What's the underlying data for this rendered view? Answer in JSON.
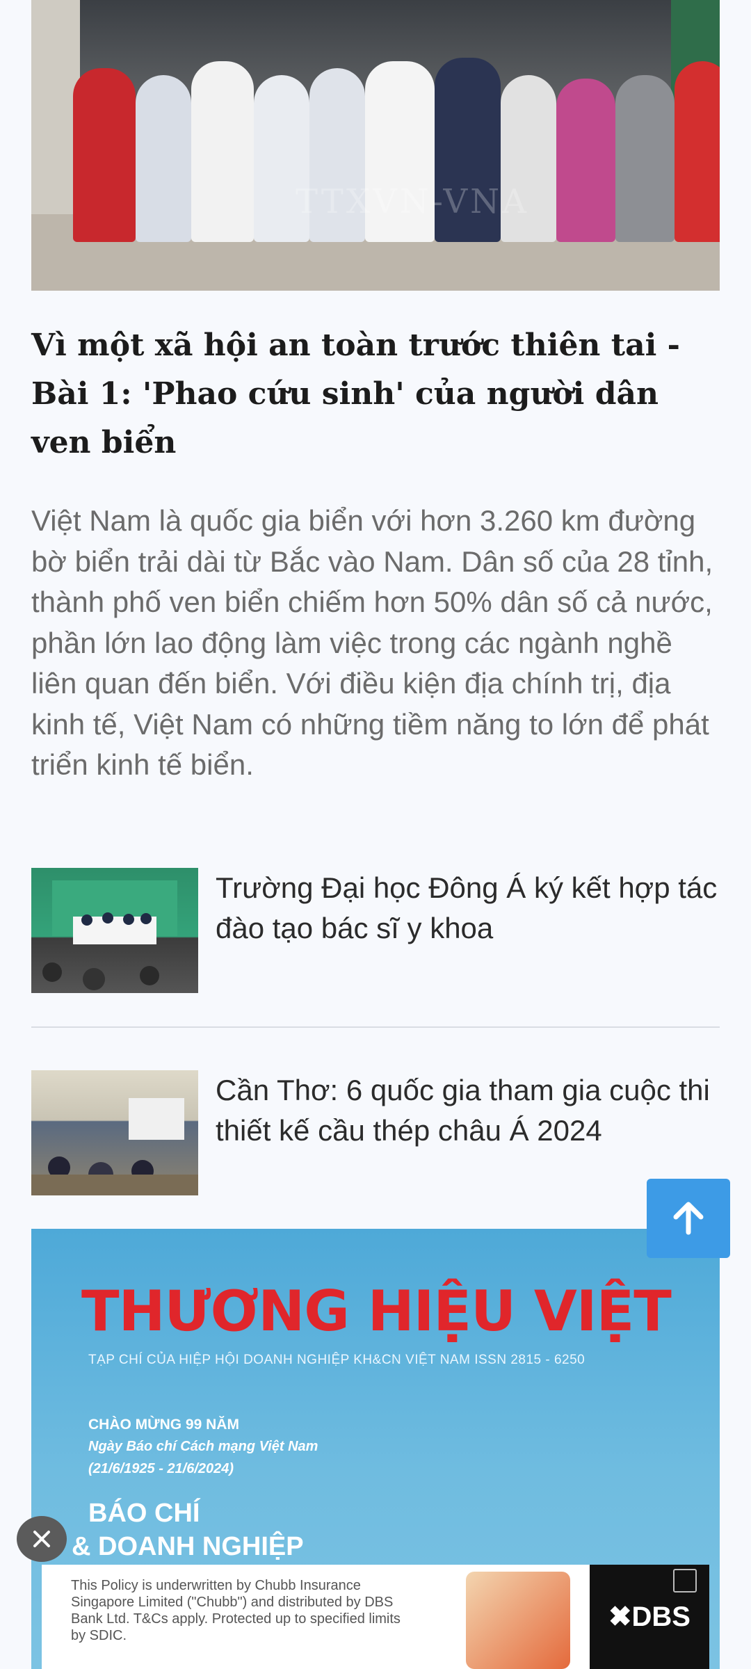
{
  "hero": {
    "watermark": "TTXVN-VNA"
  },
  "article": {
    "title": "Vì một xã hội an toàn trước thiên tai - Bài 1: 'Phao cứu sinh' của người dân ven biển",
    "summary": "Việt Nam là quốc gia biển với hơn 3.260 km đường bờ biển trải dài từ Bắc vào Nam. Dân số của 28 tỉnh, thành phố ven biển chiếm hơn 50% dân số cả nước, phần lớn lao động làm việc trong các ngành nghề liên quan đến biển. Với điều kiện địa chính trị, địa kinh tế, Việt Nam có những tiềm năng to lớn để phát triển kinh tế biển."
  },
  "related": [
    {
      "title": "Trường Đại học Đông Á ký kết hợp tác đào tạo bác sĩ y khoa"
    },
    {
      "title": "Cần Thơ: 6 quốc gia tham gia cuộc thi thiết kế cầu thép châu Á 2024"
    }
  ],
  "ad_banner": {
    "logo": "THƯƠNG HIỆU VIỆT",
    "subtitle": "TẠP CHÍ CỦA HIỆP HỘI DOANH NGHIỆP KH&CN VIỆT NAM    ISSN 2815 - 6250",
    "welcome": "CHÀO MỪNG 99 NĂM",
    "day": "Ngày Báo chí Cách mạng Việt Nam",
    "dates": "(21/6/1925 - 21/6/2024)",
    "title1": "BÁO CHÍ",
    "title2": "& DOANH NGHIỆP"
  },
  "bottom_ad": {
    "policy": "This Policy is underwritten by Chubb Insurance Singapore Limited (\"Chubb\") and distributed by DBS Bank Ltd. T&Cs apply. Protected up to specified limits by SDIC.",
    "brand": "✖DBS"
  },
  "controls": {
    "close_label": "X"
  },
  "colors": {
    "accent": "#3d9be6",
    "logo_red": "#e0262b"
  }
}
